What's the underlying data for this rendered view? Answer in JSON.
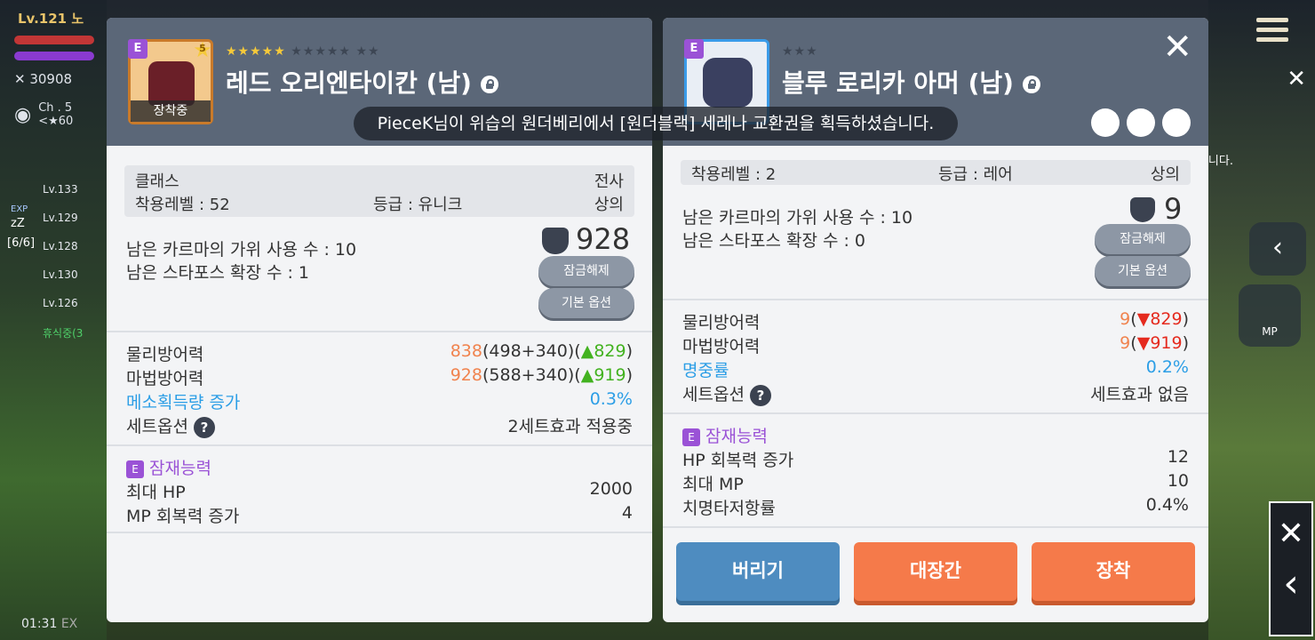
{
  "hud": {
    "level": "Lv.121",
    "name_partial": "노",
    "combat_power": "30908",
    "channel": "Ch . 5",
    "channel_sub": "<★60",
    "party": [
      "Lv.133",
      "Lv.129",
      "Lv.128",
      "Lv.130",
      "Lv.126"
    ],
    "party_status": "휴식중(3",
    "exp_label": "EXP",
    "zz": "zZ",
    "party_count": "[6/6]",
    "time": "01:31",
    "time_suffix": "EX",
    "mp_label": "MP",
    "side_text": "중입니다."
  },
  "toast": "PieceK님이 위습의 원더베리에서 [원더블랙] 세레나 교환권을 획득하셨습니다.",
  "left_item": {
    "grade_badge": "E",
    "star_level": "5",
    "equipped_label": "장착중",
    "stars_filled": 5,
    "stars_total": 12,
    "name": "레드 오리엔타이칸 (남)",
    "class_label": "클래스",
    "class_value": "전사",
    "req_level": "착용레벨 :  52",
    "grade": "등급 :  유니크",
    "quality": "상의",
    "karma": "남은 카르마의 가위 사용 수 :  10",
    "starforce": "남은 스타포스 확장 수 : 1",
    "power": "928",
    "btn_unlock": "잠금해제",
    "btn_basic": "기본 옵션",
    "stats": [
      {
        "label": "물리방어력",
        "main": "838",
        "detail": "(498+340)(",
        "arrow": "▲",
        "delta": "829",
        "tail": ")"
      },
      {
        "label": "마법방어력",
        "main": "928",
        "detail": "(588+340)(",
        "arrow": "▲",
        "delta": "919",
        "tail": ")"
      }
    ],
    "meso_label": "메소획득량 증가",
    "meso_value": "0.3%",
    "set_label": "세트옵션",
    "set_value": "2세트효과 적용중",
    "potential_badge": "E",
    "potential_title": "잠재능력",
    "potentials": [
      {
        "label": "최대 HP",
        "value": "2000"
      },
      {
        "label": "MP 회복력 증가",
        "value": "4"
      }
    ]
  },
  "right_item": {
    "grade_badge": "E",
    "stars_filled": 0,
    "stars_total": 3,
    "name": "블루 로리카 아머 (남)",
    "req_level": "착용레벨 :  2",
    "grade": "등급 :  레어",
    "quality": "상의",
    "karma": "남은 카르마의 가위 사용 수 :  10",
    "starforce": "남은 스타포스 확장 수 : 0",
    "power": "9",
    "btn_unlock": "잠금해제",
    "btn_basic": "기본 옵션",
    "stats": [
      {
        "label": "물리방어력",
        "main": "9",
        "detail": "(",
        "arrow": "▼",
        "delta": "829",
        "tail": ")"
      },
      {
        "label": "마법방어력",
        "main": "9",
        "detail": "(",
        "arrow": "▼",
        "delta": "919",
        "tail": ")"
      }
    ],
    "acc_label": "명중률",
    "acc_value": "0.2%",
    "set_label": "세트옵션",
    "set_value": "세트효과 없음",
    "potential_badge": "E",
    "potential_title": "잠재능력",
    "potentials": [
      {
        "label": "HP 회복력 증가",
        "value": "12"
      },
      {
        "label": "최대 MP",
        "value": "10"
      },
      {
        "label": "치명타저항률",
        "value": "0.4%"
      }
    ],
    "btn_discard": "버리기",
    "btn_forge": "대장간",
    "btn_equip": "장착"
  },
  "colors": {
    "panel_header": "#5b6778",
    "discard_btn": "#4e8cc0",
    "orange_btn": "#f57a4a"
  }
}
